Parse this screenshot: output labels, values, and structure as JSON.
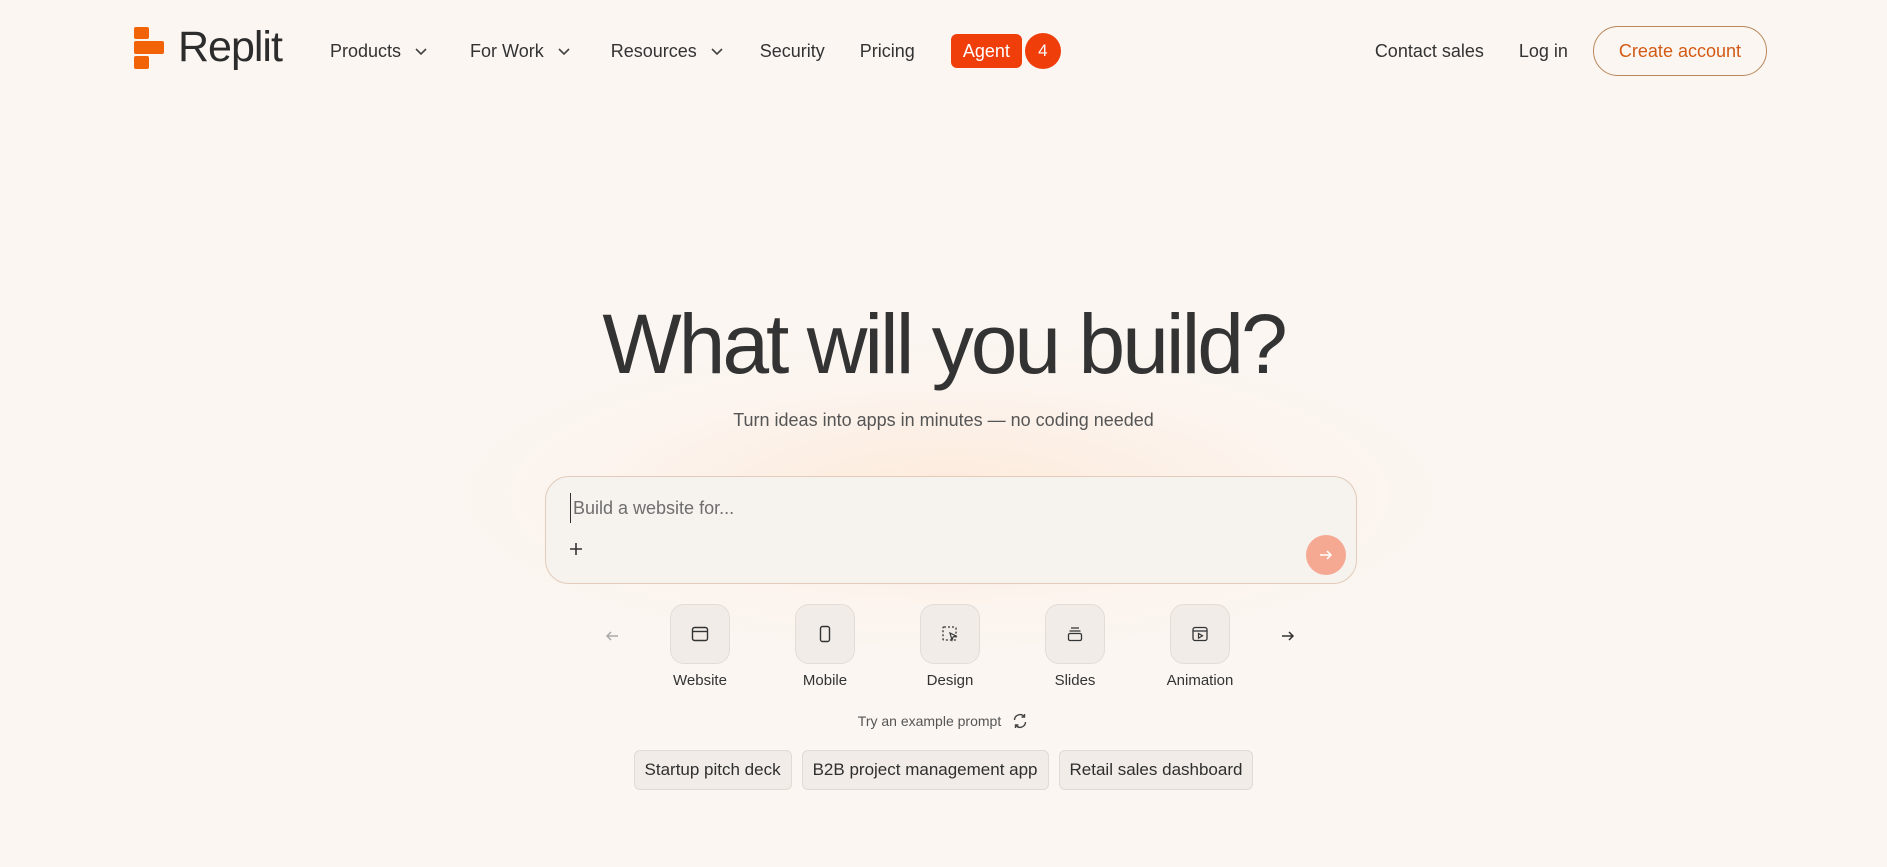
{
  "brand": {
    "name": "Replit",
    "accent": "#f26207"
  },
  "nav": {
    "links": [
      {
        "label": "Products",
        "dropdown": true
      },
      {
        "label": "For Work",
        "dropdown": true
      },
      {
        "label": "Resources",
        "dropdown": true
      },
      {
        "label": "Security",
        "dropdown": false
      },
      {
        "label": "Pricing",
        "dropdown": false
      }
    ],
    "agent": {
      "label": "Agent",
      "badge": "4"
    },
    "contact": "Contact sales",
    "login": "Log in",
    "create": "Create account"
  },
  "hero": {
    "title": "What will you build?",
    "subtitle": "Turn ideas into apps in minutes — no coding needed",
    "input_placeholder": "Build a website for..."
  },
  "categories": [
    {
      "label": "Website",
      "icon": "browser-window-icon"
    },
    {
      "label": "Mobile",
      "icon": "phone-icon"
    },
    {
      "label": "Design",
      "icon": "design-select-icon"
    },
    {
      "label": "Slides",
      "icon": "slides-stack-icon"
    },
    {
      "label": "Animation",
      "icon": "animation-play-icon"
    }
  ],
  "examples": {
    "label": "Try an example prompt",
    "chips": [
      "Startup pitch deck",
      "B2B project management app",
      "Retail sales dashboard"
    ]
  }
}
